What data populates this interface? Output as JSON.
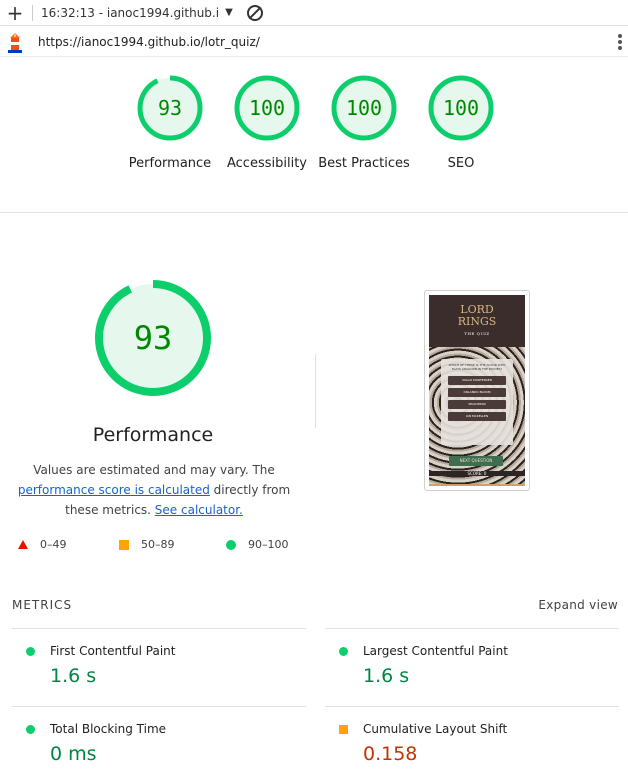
{
  "toolbar": {
    "plus_icon": "plus-icon",
    "report_label": "16:32:13 - ianoc1994.github.i",
    "caret_icon": "chevron-down-icon",
    "block_icon": "no-entry-icon"
  },
  "urlbar": {
    "url": "https://ianoc1994.github.io/lotr_quiz/",
    "logo_icon": "lighthouse-icon",
    "menu_icon": "kebab-menu-icon"
  },
  "gauges": [
    {
      "score": "93",
      "label": "Performance",
      "value": 93
    },
    {
      "score": "100",
      "label": "Accessibility",
      "value": 100
    },
    {
      "score": "100",
      "label": "Best Practices",
      "value": 100
    },
    {
      "score": "100",
      "label": "SEO",
      "value": 100
    }
  ],
  "performance": {
    "score": "93",
    "value": 93,
    "title": "Performance",
    "desc_pre": "Values are estimated and may vary. The ",
    "desc_link1": "performance score is calculated",
    "desc_mid": " directly from these metrics. ",
    "desc_link2": "See calculator."
  },
  "legend": [
    {
      "range": "0–49",
      "icon": "red-triangle-icon"
    },
    {
      "range": "50–89",
      "icon": "orange-square-icon"
    },
    {
      "range": "90–100",
      "icon": "green-circle-icon"
    }
  ],
  "thumbnail": {
    "title_line1": "LORD",
    "title_line2": "RINGS",
    "subtitle": "THE QUIZ",
    "question": "WHICH OF THESE IS THE ACTOR WHO PLAYS ARAGORN IN THE MOVIES?",
    "options": [
      "VIGGO MORTENSEN",
      "ORLANDO BLOOM",
      "SEAN BEAN",
      "IAN MCKELLEN"
    ],
    "next_label": "NEXT QUESTION",
    "score_label": "SCORE: 0"
  },
  "metrics": {
    "header": "METRICS",
    "expand": "Expand view",
    "items": [
      {
        "name": "First Contentful Paint",
        "value": "1.6 s",
        "status": "good"
      },
      {
        "name": "Largest Contentful Paint",
        "value": "1.6 s",
        "status": "good"
      },
      {
        "name": "Total Blocking Time",
        "value": "0 ms",
        "status": "good"
      },
      {
        "name": "Cumulative Layout Shift",
        "value": "0.158",
        "status": "average"
      }
    ]
  },
  "colors": {
    "pass": "#0cce6b",
    "pass_text": "#008800",
    "average": "#ffa400",
    "fail": "#eb0f00",
    "link": "#1a5fd3"
  }
}
